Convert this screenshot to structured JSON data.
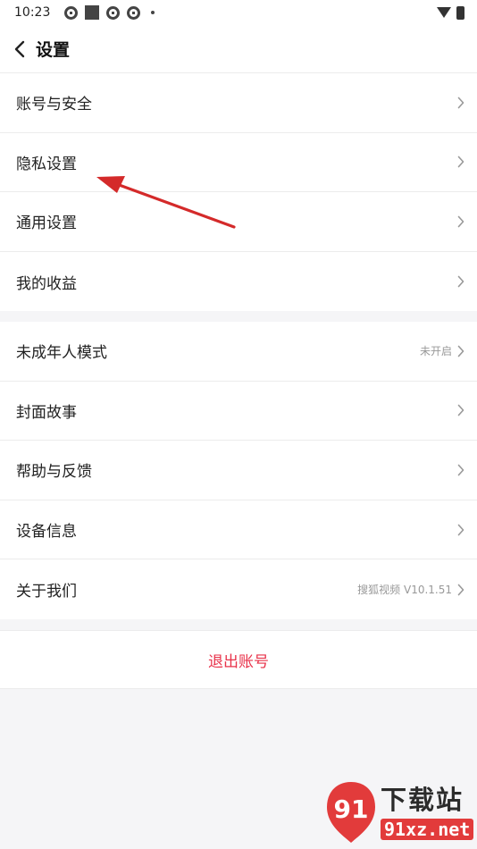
{
  "status_bar": {
    "time": "10:23",
    "icons": [
      "app-notification-icon",
      "stop-square-icon",
      "app-notification-icon",
      "app-notification-icon",
      "dot-icon",
      "wifi-icon",
      "battery-icon"
    ]
  },
  "header": {
    "back_icon": "chevron-left-icon",
    "title": "设置"
  },
  "groups": [
    {
      "items": [
        {
          "label": "账号与安全",
          "value": ""
        },
        {
          "label": "隐私设置",
          "value": ""
        },
        {
          "label": "通用设置",
          "value": ""
        },
        {
          "label": "我的收益",
          "value": ""
        }
      ]
    },
    {
      "items": [
        {
          "label": "未成年人模式",
          "value": "未开启"
        },
        {
          "label": "封面故事",
          "value": ""
        },
        {
          "label": "帮助与反馈",
          "value": ""
        },
        {
          "label": "设备信息",
          "value": ""
        },
        {
          "label": "关于我们",
          "value": "搜狐视频 V10.1.51"
        }
      ]
    }
  ],
  "logout_label": "退出账号",
  "colors": {
    "accent": "#e8324a",
    "annotation_arrow": "#d42a2a",
    "background": "#f5f5f7"
  },
  "watermark": {
    "top": "下载站",
    "bottom": "91xz.net",
    "logo": "91"
  }
}
